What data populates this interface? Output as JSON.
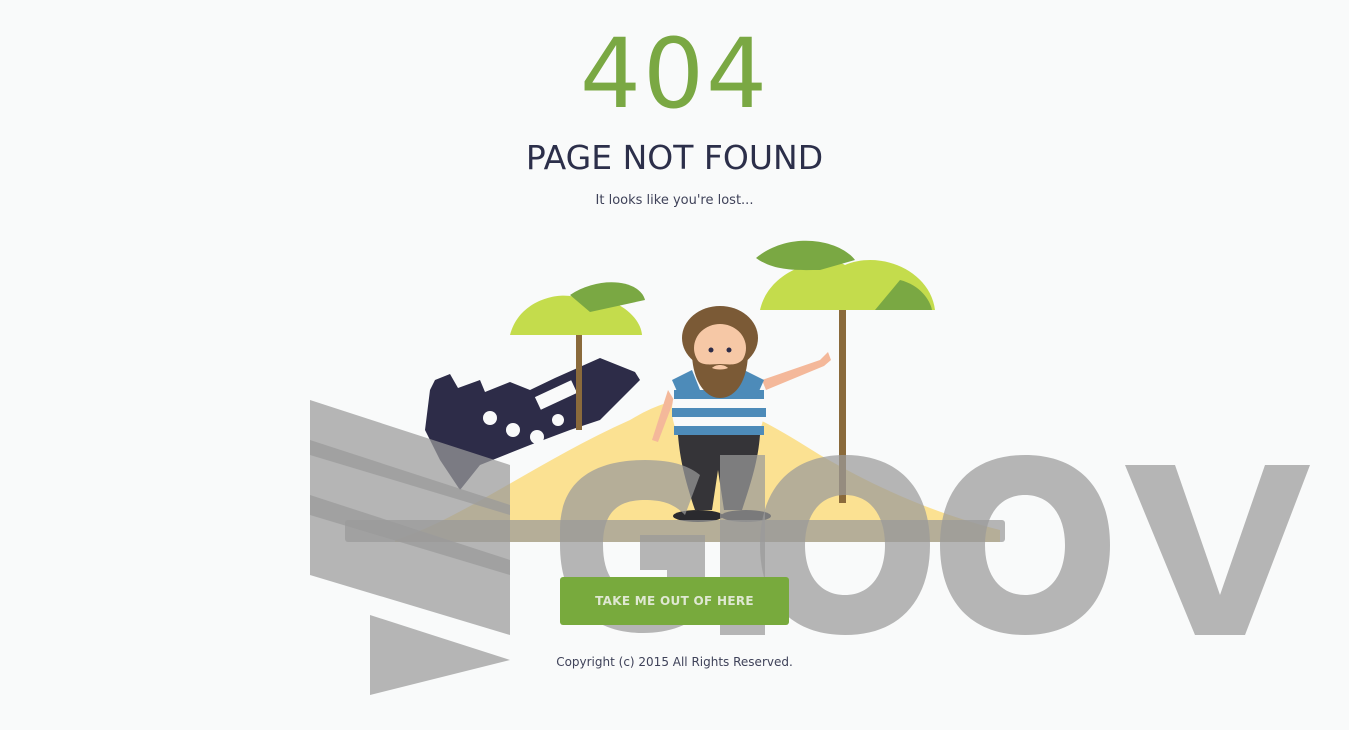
{
  "error": {
    "code": "404",
    "title": "PAGE NOT FOUND",
    "message": "It looks like you're lost..."
  },
  "actions": {
    "home_button_label": "TAKE ME OUT OF HERE"
  },
  "footer": {
    "copyright": "Copyright (c) 2015 All Rights Reserved."
  },
  "colors": {
    "accent": "#78aa3d",
    "heading": "#2c2f4a",
    "background": "#f9fafa"
  },
  "illustration": {
    "elements": [
      "shipwreck",
      "sand-island",
      "palm-tree",
      "bearded-sailor",
      "watermark-logo"
    ]
  }
}
